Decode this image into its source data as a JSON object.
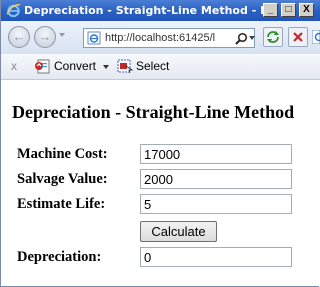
{
  "window": {
    "title": "Depreciation - Straight-Line Method - In...",
    "controls": {
      "minimize": "_",
      "maximize": "□",
      "close": "X"
    }
  },
  "navbar": {
    "back_icon": "back-arrow-icon",
    "forward_icon": "forward-arrow-icon",
    "address_url": "http://localhost:61425/l",
    "page_icon": "ie-page-icon",
    "search_icon": "search-icon",
    "refresh_icon": "refresh-icon",
    "stop_icon": "stop-icon"
  },
  "commandbar": {
    "close_label": "x",
    "convert_label": "Convert",
    "select_label": "Select"
  },
  "form": {
    "heading": "Depreciation - Straight-Line Method",
    "machine_cost_label": "Machine Cost:",
    "machine_cost_value": "17000",
    "salvage_value_label": "Salvage Value:",
    "salvage_value_value": "2000",
    "estimate_life_label": "Estimate Life:",
    "estimate_life_value": "5",
    "calculate_label": "Calculate",
    "depreciation_label": "Depreciation:",
    "depreciation_value": "0"
  },
  "colors": {
    "titlebar": "#2a5fc2",
    "title_text": "#ffffff"
  }
}
